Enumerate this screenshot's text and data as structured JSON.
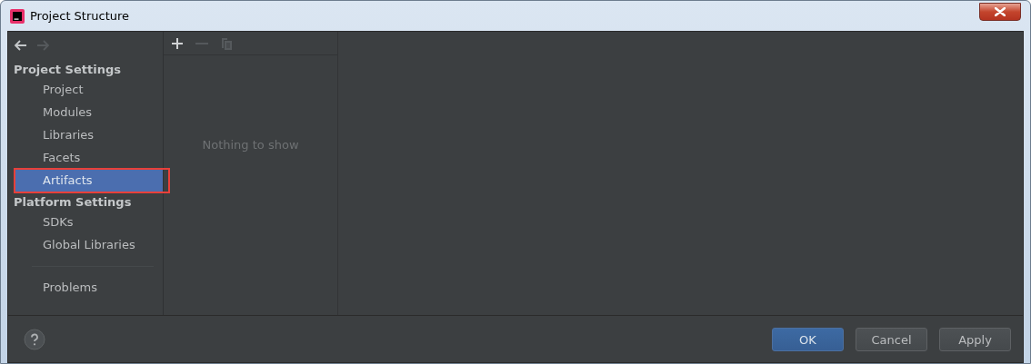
{
  "window": {
    "title": "Project Structure"
  },
  "sidebar": {
    "nav": [
      {
        "kind": "back",
        "disabled": false
      },
      {
        "kind": "forward",
        "disabled": true
      }
    ],
    "groups": [
      {
        "title": "Project Settings",
        "items": [
          {
            "label": "Project",
            "selected": false,
            "highlighted": false
          },
          {
            "label": "Modules",
            "selected": false,
            "highlighted": false
          },
          {
            "label": "Libraries",
            "selected": false,
            "highlighted": false
          },
          {
            "label": "Facets",
            "selected": false,
            "highlighted": false
          },
          {
            "label": "Artifacts",
            "selected": true,
            "highlighted": true
          }
        ]
      },
      {
        "title": "Platform Settings",
        "items": [
          {
            "label": "SDKs",
            "selected": false,
            "highlighted": false
          },
          {
            "label": "Global Libraries",
            "selected": false,
            "highlighted": false
          }
        ]
      }
    ],
    "footer_items": [
      {
        "label": "Problems",
        "selected": false,
        "highlighted": false
      }
    ]
  },
  "list_panel": {
    "toolbar": [
      {
        "kind": "add",
        "disabled": false
      },
      {
        "kind": "remove",
        "disabled": true
      },
      {
        "kind": "copy",
        "disabled": true
      }
    ],
    "empty_text": "Nothing to show"
  },
  "buttons": [
    {
      "label": "OK",
      "kind": "primary"
    },
    {
      "label": "Cancel",
      "kind": "normal"
    },
    {
      "label": "Apply",
      "kind": "normal"
    }
  ]
}
